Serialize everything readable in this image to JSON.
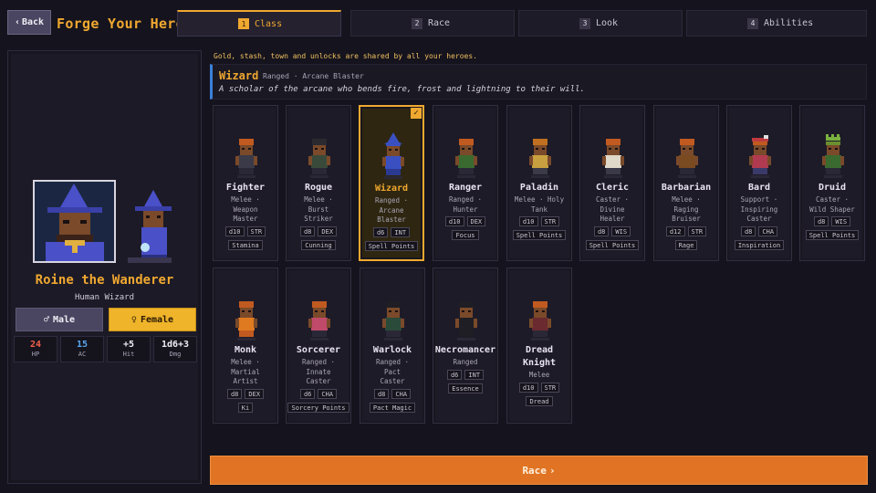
{
  "header": {
    "back_label": "Back",
    "title": "Forge Your Hero",
    "tabs": [
      {
        "num": "1",
        "label": "Class",
        "active": true
      },
      {
        "num": "2",
        "label": "Race",
        "active": false
      },
      {
        "num": "3",
        "label": "Look",
        "active": false
      },
      {
        "num": "4",
        "label": "Abilities",
        "active": false
      }
    ]
  },
  "hero": {
    "name": "Roine the Wanderer",
    "subtitle": "Human Wizard",
    "gender_male": "Male",
    "gender_female": "Female",
    "gender_selected": "Female",
    "stats": [
      {
        "value": "24",
        "label": "HP",
        "color": "#f0604a"
      },
      {
        "value": "15",
        "label": "AC",
        "color": "#5aa8f0"
      },
      {
        "value": "+5",
        "label": "Hit",
        "color": "#f0eef5"
      },
      {
        "value": "1d6+3",
        "label": "Dmg",
        "color": "#f0eef5"
      }
    ]
  },
  "main": {
    "shared_note": "Gold, stash, town and unlocks are shared by all your heroes.",
    "selected": {
      "name": "Wizard",
      "tags": "Ranged · Arcane Blaster",
      "description": "A scholar of the arcane who bends fire, frost and lightning to their will."
    },
    "classes": [
      {
        "name": "Fighter",
        "desc": [
          "Melee ·",
          "Weapon",
          "Master"
        ],
        "die": "d10",
        "stat": "STR",
        "resource": "Stamina",
        "hair": "#c05a20",
        "shirt": "#3a3a48",
        "pants": "#2a2836",
        "hat": ""
      },
      {
        "name": "Rogue",
        "desc": [
          "Melee ·",
          "Burst",
          "Striker"
        ],
        "die": "d8",
        "stat": "DEX",
        "resource": "Cunning",
        "hair": "#2a2a30",
        "shirt": "#3a4a3a",
        "pants": "#2a2836",
        "hat": "#2a2a30"
      },
      {
        "name": "Wizard",
        "desc": [
          "Ranged ·",
          "Arcane",
          "Blaster"
        ],
        "die": "d6",
        "stat": "INT",
        "resource": "Spell Points",
        "hair": "#3a50c0",
        "shirt": "#3a50c0",
        "pants": "#2a3a90",
        "hat": "#3a50c0",
        "selected": true
      },
      {
        "name": "Ranger",
        "desc": [
          "Ranged ·",
          "Hunter"
        ],
        "die": "d10",
        "stat": "DEX",
        "resource": "Focus",
        "hair": "#c05a20",
        "shirt": "#3a6a30",
        "pants": "#2a2836",
        "hat": ""
      },
      {
        "name": "Paladin",
        "desc": [
          "Melee · Holy",
          "Tank"
        ],
        "die": "d10",
        "stat": "STR",
        "resource": "Spell Points",
        "hair": "#c07020",
        "shirt": "#c8a040",
        "pants": "#3a3a48",
        "hat": ""
      },
      {
        "name": "Cleric",
        "desc": [
          "Caster ·",
          "Divine",
          "Healer"
        ],
        "die": "d8",
        "stat": "WIS",
        "resource": "Spell Points",
        "hair": "#c05a20",
        "shirt": "#e0d8c8",
        "pants": "#3a3a48",
        "hat": ""
      },
      {
        "name": "Barbarian",
        "desc": [
          "Melee ·",
          "Raging",
          "Bruiser"
        ],
        "die": "d12",
        "stat": "STR",
        "resource": "Rage",
        "hair": "#c05a20",
        "shirt": "#7a4a20",
        "pants": "#2a2836",
        "hat": ""
      },
      {
        "name": "Bard",
        "desc": [
          "Support ·",
          "Inspiring",
          "Caster"
        ],
        "die": "d8",
        "stat": "CHA",
        "resource": "Inspiration",
        "hair": "#c05a20",
        "shirt": "#b03a50",
        "pants": "#3a3a6a",
        "hat": "#c03a40"
      },
      {
        "name": "Druid",
        "desc": [
          "Caster ·",
          "Wild Shaper"
        ],
        "die": "d8",
        "stat": "WIS",
        "resource": "Spell Points",
        "hair": "#6a9030",
        "shirt": "#3a6a30",
        "pants": "#2a2836",
        "hat": "#6a9030"
      },
      {
        "name": "Monk",
        "desc": [
          "Melee ·",
          "Martial",
          "Artist"
        ],
        "die": "d8",
        "stat": "DEX",
        "resource": "Ki",
        "hair": "#c05a20",
        "shirt": "#e07a20",
        "pants": "#c05a20",
        "hat": ""
      },
      {
        "name": "Sorcerer",
        "desc": [
          "Ranged ·",
          "Innate",
          "Caster"
        ],
        "die": "d6",
        "stat": "CHA",
        "resource": "Sorcery Points",
        "hair": "#c05a20",
        "shirt": "#c04a6a",
        "pants": "#2a2836",
        "hat": ""
      },
      {
        "name": "Warlock",
        "desc": [
          "Ranged ·",
          "Pact",
          "Caster"
        ],
        "die": "d8",
        "stat": "CHA",
        "resource": "Pact Magic",
        "hair": "#1e1e24",
        "shirt": "#2a4a3a",
        "pants": "#2a2836",
        "hat": "#1e1e24"
      },
      {
        "name": "Necromancer",
        "desc": [
          "Ranged"
        ],
        "die": "d6",
        "stat": "INT",
        "resource": "Essence",
        "hair": "#1e1e24",
        "shirt": "#1e1e24",
        "pants": "#1e1e24",
        "hat": "#1e1e24"
      },
      {
        "name": "Dread Knight",
        "desc": [
          "Melee"
        ],
        "die": "d10",
        "stat": "STR",
        "resource": "Dread",
        "hair": "#c05a20",
        "shirt": "#6a2a30",
        "pants": "#2a2836",
        "hat": ""
      }
    ],
    "next_label": "Race"
  }
}
